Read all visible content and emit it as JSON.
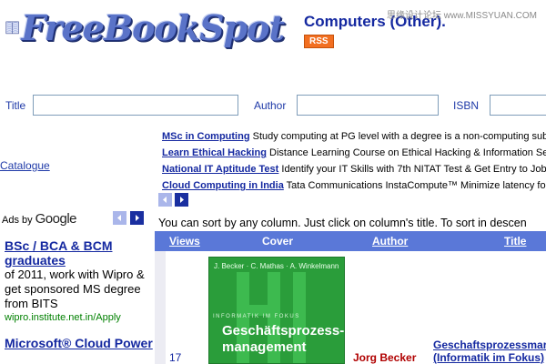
{
  "header": {
    "logo_text": "FreeBookSpot",
    "category_title": "Computers (Other).",
    "rss_label": "RSS",
    "watermark": "思缘设计论坛 www.MISSYUAN.COM"
  },
  "search": {
    "title_label": "Title",
    "author_label": "Author",
    "isbn_label": "ISBN",
    "title_value": "",
    "author_value": "",
    "isbn_value": ""
  },
  "sidebar": {
    "catalogue_link": "Catalogue"
  },
  "sponsored_links": [
    {
      "title": "MSc in Computing",
      "text": "Study computing at PG level with a degree is a non-computing sub"
    },
    {
      "title": "Learn Ethical Hacking",
      "text": "Distance Learning Course on Ethical Hacking & Information Sec"
    },
    {
      "title": "National IT Aptitude Test",
      "text": "Identify your IT Skills with 7th NITAT Test & Get Entry to Job"
    },
    {
      "title": "Cloud Computing in India",
      "text": "Tata Communications InstaCompute™ Minimize latency for"
    }
  ],
  "ads": {
    "ads_by_label": "Ads by",
    "google_label": "Google",
    "items": [
      {
        "title": "BSc / BCA & BCM graduates",
        "body": "of 2011, work with Wipro & get sponsored MS degree from BITS",
        "url": "wipro.institute.net.in/Apply"
      },
      {
        "title": "Microsoft® Cloud Power",
        "body": "",
        "url": ""
      }
    ]
  },
  "table": {
    "sort_note": "You can sort by any column. Just click on column's title. To sort in descen",
    "columns": [
      "Views",
      "Cover",
      "Author",
      "Title"
    ],
    "rows": [
      {
        "views": "17",
        "cover_authors": "J. Becker · C. Mathas · A. Winkelmann",
        "cover_series": "INFORMATIK IM FOKUS",
        "cover_title_line1": "Geschäftsprozess-",
        "cover_title_line2": "management",
        "author": "Jorg Becker",
        "title_line1": "Geschaftsprozessmar",
        "title_line2": "(Informatik im Fokus)"
      }
    ]
  },
  "colors": {
    "link_blue": "#1428a0",
    "header_bar": "#5a78d8",
    "rss_orange": "#f26f21",
    "cover_green": "#2a9d3a",
    "author_red": "#b00000",
    "ad_url_green": "#008000"
  }
}
